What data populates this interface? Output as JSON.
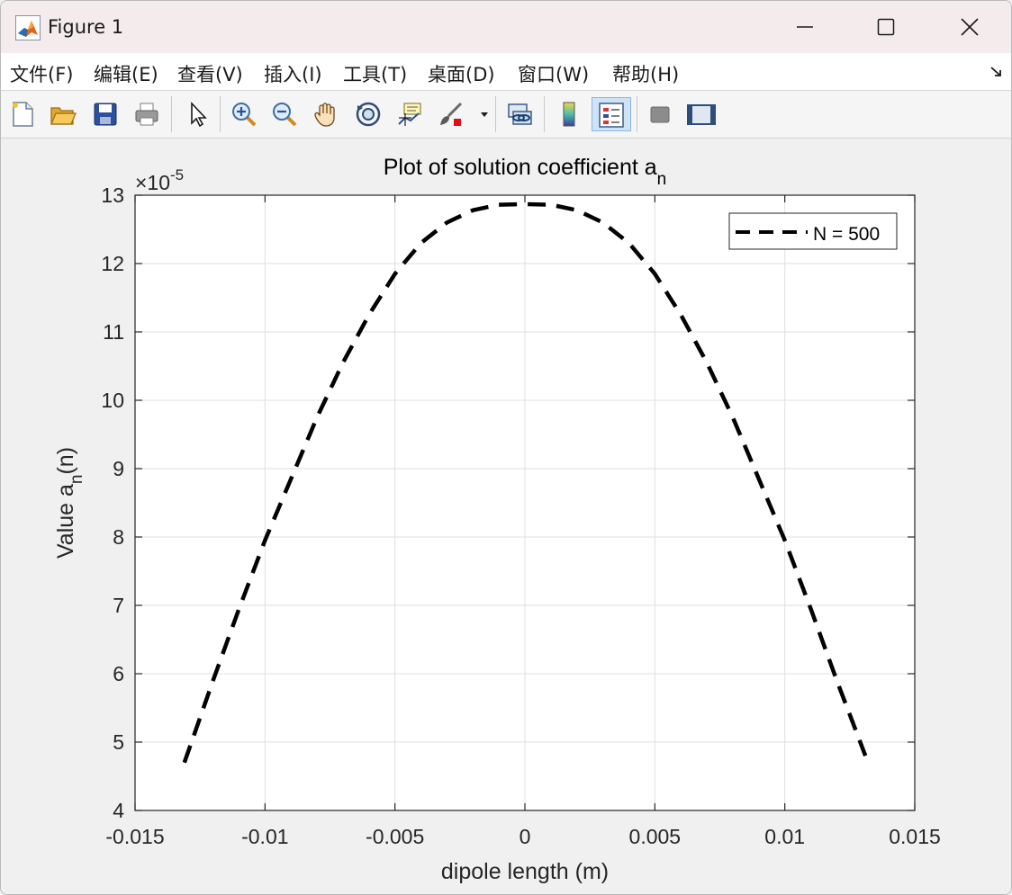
{
  "window": {
    "title": "Figure 1"
  },
  "menu": {
    "items": [
      "文件(F)",
      "编辑(E)",
      "查看(V)",
      "插入(I)",
      "工具(T)",
      "桌面(D)",
      "窗口(W)",
      "帮助(H)"
    ]
  },
  "toolbar": {
    "tools": [
      {
        "name": "new-figure-icon"
      },
      {
        "name": "open-file-icon"
      },
      {
        "name": "save-icon"
      },
      {
        "name": "print-icon"
      },
      {
        "name": "pointer-icon"
      },
      {
        "name": "zoom-in-icon"
      },
      {
        "name": "zoom-out-icon"
      },
      {
        "name": "pan-hand-icon"
      },
      {
        "name": "rotate-3d-icon"
      },
      {
        "name": "data-cursor-icon"
      },
      {
        "name": "brush-icon"
      },
      {
        "name": "link-plot-icon"
      },
      {
        "name": "colorbar-icon"
      },
      {
        "name": "legend-icon",
        "active": true
      },
      {
        "name": "hide-plot-tools-icon"
      },
      {
        "name": "show-plot-tools-icon"
      }
    ]
  },
  "chart_data": {
    "type": "line",
    "title": "Plot of solution coefficient a",
    "title_subscript": "n",
    "xlabel": "dipole length (m)",
    "ylabel": "Value a",
    "ylabel_subscript": "n",
    "ylabel_suffix": "(n)",
    "exponent_label": "×10",
    "exponent_power": "-5",
    "xlim": [
      -0.015,
      0.015
    ],
    "ylim": [
      4,
      13
    ],
    "xticks": [
      -0.015,
      -0.01,
      -0.005,
      0,
      0.005,
      0.01,
      0.015
    ],
    "xtick_labels": [
      "-0.015",
      "-0.01",
      "-0.005",
      "0",
      "0.005",
      "0.01",
      "0.015"
    ],
    "yticks": [
      4,
      5,
      6,
      7,
      8,
      9,
      10,
      11,
      12,
      13
    ],
    "ytick_labels": [
      "4",
      "5",
      "6",
      "7",
      "8",
      "9",
      "10",
      "11",
      "12",
      "13"
    ],
    "grid": true,
    "legend_position": "top-right",
    "series": [
      {
        "name": "N = 500",
        "color": "#000000",
        "line_style": "dashed",
        "x": [
          -0.0131,
          -0.012,
          -0.011,
          -0.01,
          -0.009,
          -0.008,
          -0.007,
          -0.006,
          -0.005,
          -0.004,
          -0.003,
          -0.002,
          -0.001,
          0,
          0.001,
          0.002,
          0.003,
          0.004,
          0.005,
          0.006,
          0.007,
          0.008,
          0.009,
          0.01,
          0.011,
          0.012,
          0.0131
        ],
        "y": [
          4.7,
          5.9,
          6.95,
          7.95,
          8.85,
          9.75,
          10.55,
          11.25,
          11.85,
          12.3,
          12.6,
          12.78,
          12.86,
          12.87,
          12.86,
          12.78,
          12.6,
          12.3,
          11.85,
          11.25,
          10.55,
          9.75,
          8.85,
          7.95,
          6.95,
          5.9,
          4.8
        ]
      }
    ]
  }
}
